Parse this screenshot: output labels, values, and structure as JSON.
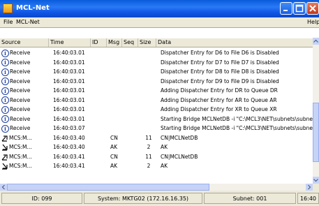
{
  "window": {
    "title": "MCL-Net"
  },
  "menu": {
    "file": "File",
    "mclnet": "MCL-Net",
    "help": "Help"
  },
  "columns": [
    "Source",
    "Time",
    "ID",
    "Msg",
    "Seq",
    "Size",
    "Data"
  ],
  "rows": [
    {
      "icon": "info",
      "source": "Receive",
      "time": "16:40:03.01",
      "id": "",
      "msg": "",
      "seq": "",
      "size": "",
      "data": "Dispatcher Entry for D6 to File D6 is Disabled"
    },
    {
      "icon": "info",
      "source": "Receive",
      "time": "16:40:03.01",
      "id": "",
      "msg": "",
      "seq": "",
      "size": "",
      "data": "Dispatcher Entry for D7 to File D7 is Disabled"
    },
    {
      "icon": "info",
      "source": "Receive",
      "time": "16:40:03.01",
      "id": "",
      "msg": "",
      "seq": "",
      "size": "",
      "data": "Dispatcher Entry for D8 to File D8 is Disabled"
    },
    {
      "icon": "info",
      "source": "Receive",
      "time": "16:40:03.01",
      "id": "",
      "msg": "",
      "seq": "",
      "size": "",
      "data": "Dispatcher Entry for D9 to File D9 is Disabled"
    },
    {
      "icon": "info",
      "source": "Receive",
      "time": "16:40:03.01",
      "id": "",
      "msg": "",
      "seq": "",
      "size": "",
      "data": "Adding Dispatcher Entry for DR to Queue DR"
    },
    {
      "icon": "info",
      "source": "Receive",
      "time": "16:40:03.01",
      "id": "",
      "msg": "",
      "seq": "",
      "size": "",
      "data": "Adding Dispatcher Entry for AR to Queue AR"
    },
    {
      "icon": "info",
      "source": "Receive",
      "time": "16:40:03.01",
      "id": "",
      "msg": "",
      "seq": "",
      "size": "",
      "data": "Adding Dispatcher Entry for XR to Queue XR"
    },
    {
      "icon": "info",
      "source": "Receive",
      "time": "16:40:03.01",
      "id": "",
      "msg": "",
      "seq": "",
      "size": "",
      "data": "Starting Bridge MCLNetDB -i \"C:\\MCL3\\NET\\subnets\\subne"
    },
    {
      "icon": "info",
      "source": "Receive",
      "time": "16:40:03.07",
      "id": "",
      "msg": "",
      "seq": "",
      "size": "",
      "data": "Starting Bridge MCLNetDB -i \"C:\\MCL3\\NET\\subnets\\subne"
    },
    {
      "icon": "send",
      "source": "MCS:M...",
      "time": "16:40:03.40",
      "id": "",
      "msg": "CN",
      "seq": "",
      "size": "11",
      "data": "CN|MCLNetDB"
    },
    {
      "icon": "recv",
      "source": "MCS:M...",
      "time": "16:40:03.40",
      "id": "",
      "msg": "AK",
      "seq": "",
      "size": "2",
      "data": "AK"
    },
    {
      "icon": "send",
      "source": "MCS:M...",
      "time": "16:40:03.41",
      "id": "",
      "msg": "CN",
      "seq": "",
      "size": "11",
      "data": "CN|MCLNetDB"
    },
    {
      "icon": "recv",
      "source": "MCS:M...",
      "time": "16:40:03.41",
      "id": "",
      "msg": "AK",
      "seq": "",
      "size": "2",
      "data": "AK"
    }
  ],
  "status": {
    "id": "ID: 099",
    "system": "System: MKTG02 (172.16.16.35)",
    "subnet": "Subnet: 001",
    "time": "16:40"
  },
  "colors": {
    "titlebar": "#0a5bdc",
    "info_icon": "#1c3fa0",
    "chrome": "#ece9d8"
  }
}
